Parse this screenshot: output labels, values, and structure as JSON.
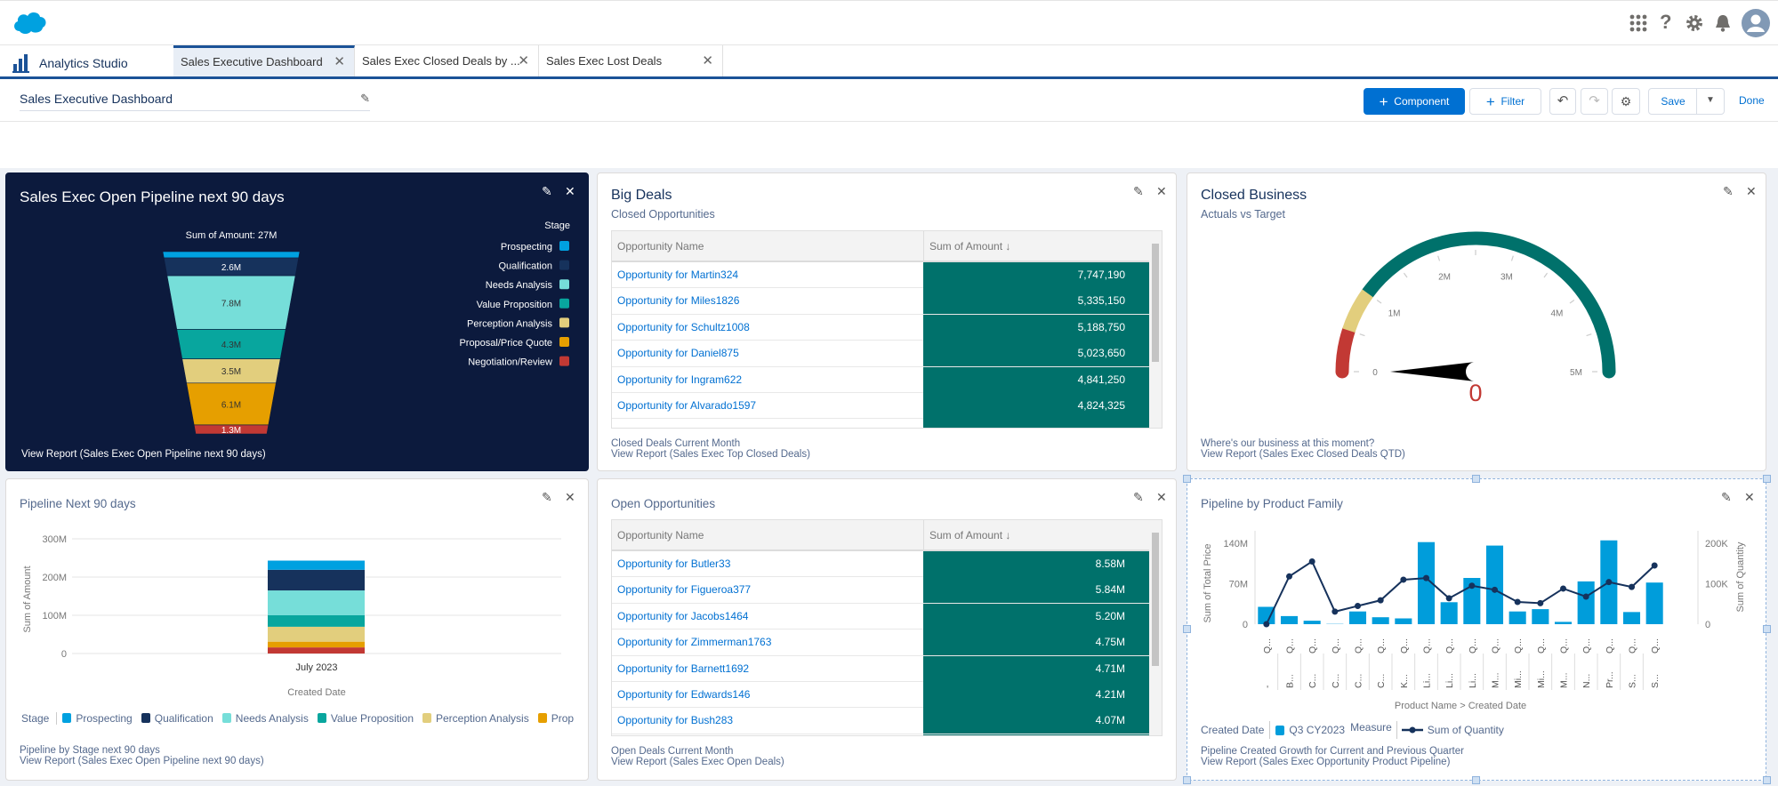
{
  "header": {
    "logo": "salesforce-cloud-logo",
    "icons": [
      "app-launcher-icon",
      "help-icon",
      "setup-gear-icon",
      "notification-bell-icon",
      "user-avatar"
    ]
  },
  "tabs": {
    "app_name": "Analytics Studio",
    "items": [
      {
        "label": "Sales Executive Dashboard",
        "active": true
      },
      {
        "label": "Sales Exec Closed Deals by ...",
        "active": false
      },
      {
        "label": "Sales Exec Lost Deals",
        "active": false
      }
    ]
  },
  "toolbar": {
    "dashboard_title": "Sales Executive Dashboard",
    "component_label": "Component",
    "filter_label": "Filter",
    "save_label": "Save",
    "done_label": "Done"
  },
  "widgets": {
    "funnel": {
      "title": "Sales Exec Open Pipeline next 90 days",
      "total_label": "Sum of Amount: 27M",
      "legend_title": "Stage",
      "footer_link": "View Report (Sales Exec Open Pipeline next 90 days)"
    },
    "big_deals": {
      "title": "Big Deals",
      "subtitle": "Closed Opportunities",
      "columns": [
        "Opportunity Name",
        "Sum of Amount ↓"
      ],
      "rows": [
        [
          "Opportunity for Martin324",
          "7,747,190"
        ],
        [
          "Opportunity for Miles1826",
          "5,335,150"
        ],
        [
          "Opportunity for Schultz1008",
          "5,188,750"
        ],
        [
          "Opportunity for Daniel875",
          "5,023,650"
        ],
        [
          "Opportunity for Ingram622",
          "4,841,250"
        ],
        [
          "Opportunity for Alvarado1597",
          "4,824,325"
        ]
      ],
      "footer_text": "Closed Deals Current Month",
      "footer_link": "View Report (Sales Exec Top Closed Deals)"
    },
    "closed_business": {
      "title": "Closed Business",
      "subtitle": "Actuals vs Target",
      "value_label": "0",
      "footer_text": "Where's our business at this moment?",
      "footer_link": "View Report (Sales Exec Closed Deals QTD)"
    },
    "pipeline_next": {
      "title": "Pipeline Next 90 days",
      "legend_title": "Stage",
      "footer_text": "Pipeline by Stage next 90 days",
      "footer_link": "View Report (Sales Exec Open Pipeline next 90 days)"
    },
    "open_opps": {
      "title": "Open Opportunities",
      "columns": [
        "Opportunity Name",
        "Sum of Amount ↓"
      ],
      "rows": [
        [
          "Opportunity for Butler33",
          "8.58M"
        ],
        [
          "Opportunity for Figueroa377",
          "5.84M"
        ],
        [
          "Opportunity for Jacobs1464",
          "5.20M"
        ],
        [
          "Opportunity for Zimmerman1763",
          "4.75M"
        ],
        [
          "Opportunity for Barnett1692",
          "4.71M"
        ],
        [
          "Opportunity for Edwards146",
          "4.21M"
        ],
        [
          "Opportunity for Bush283",
          "4.07M"
        ]
      ],
      "footer_text": "Open Deals Current Month",
      "footer_link": "View Report (Sales Exec Open Deals)"
    },
    "product_family": {
      "title": "Pipeline by Product Family",
      "legend": {
        "dim_title": "Created Date",
        "dim_item": "Q3 CY2023",
        "measure_title": "Measure",
        "measure_item": "Sum of Quantity"
      },
      "footer_text": "Pipeline Created Growth for Current and Previous Quarter",
      "footer_link": "View Report (Sales Exec Opportunity Product Pipeline)"
    }
  },
  "colors": {
    "prospecting": "#00a1e0",
    "qualification": "#16325c",
    "needs_analysis": "#76ded9",
    "value_proposition": "#08a69e",
    "perception_analysis": "#e2ce7d",
    "proposal": "#e69f00",
    "negotiation": "#c23934",
    "table_bar": "#00716b",
    "brand": "#0070d2",
    "bar_blue": "#009ddb",
    "line_navy": "#16325c"
  },
  "chart_data": [
    {
      "type": "funnel",
      "title": "Sales Exec Open Pipeline next 90 days",
      "total": "Sum of Amount: 27M",
      "legend_position": "right",
      "stages": [
        {
          "name": "Prospecting",
          "color": "#00a1e0",
          "label": ""
        },
        {
          "name": "Qualification",
          "color": "#16325c",
          "value": 2.6,
          "label": "2.6M"
        },
        {
          "name": "Needs Analysis",
          "color": "#76ded9",
          "value": 7.8,
          "label": "7.8M"
        },
        {
          "name": "Value Proposition",
          "color": "#08a69e",
          "value": 4.3,
          "label": "4.3M"
        },
        {
          "name": "Perception Analysis",
          "color": "#e2ce7d",
          "value": 3.5,
          "label": "3.5M"
        },
        {
          "name": "Proposal/Price Quote",
          "color": "#e69f00",
          "value": 6.1,
          "label": "6.1M"
        },
        {
          "name": "Negotiation/Review",
          "color": "#c23934",
          "value": 1.3,
          "label": "1.3M"
        }
      ]
    },
    {
      "type": "gauge",
      "min": 0,
      "max": 5,
      "unit": "M",
      "value": 0,
      "tick_labels": [
        "0",
        "1M",
        "2M",
        "3M",
        "4M",
        "5M"
      ],
      "bands": [
        {
          "from": 0,
          "to": 0.5,
          "color": "#c23934"
        },
        {
          "from": 0.5,
          "to": 1,
          "color": "#e2ce7d"
        },
        {
          "from": 1,
          "to": 5,
          "color": "#00716b"
        }
      ]
    },
    {
      "type": "bar",
      "stacked": true,
      "categories": [
        "July 2023"
      ],
      "xlabel": "Created Date",
      "ylabel": "Sum of Amount",
      "ylim": [
        0,
        300
      ],
      "yticks": [
        "0",
        "100M",
        "200M",
        "300M"
      ],
      "grid": true,
      "legend_position": "bottom",
      "series": [
        {
          "name": "Negotiation/Review",
          "color": "#c23934",
          "values": [
            16
          ]
        },
        {
          "name": "Proposal/Price Quote",
          "color": "#e69f00",
          "values": [
            15
          ]
        },
        {
          "name": "Perception Analysis",
          "color": "#e2ce7d",
          "values": [
            39
          ]
        },
        {
          "name": "Value Proposition",
          "color": "#08a69e",
          "values": [
            30
          ]
        },
        {
          "name": "Needs Analysis",
          "color": "#76ded9",
          "values": [
            65
          ]
        },
        {
          "name": "Qualification",
          "color": "#16325c",
          "values": [
            54
          ]
        },
        {
          "name": "Prospecting",
          "color": "#00a1e0",
          "values": [
            24
          ]
        }
      ],
      "legend": [
        "Prospecting",
        "Qualification",
        "Needs Analysis",
        "Value Proposition",
        "Perception Analysis",
        "Prop"
      ]
    },
    {
      "type": "bar+line",
      "xlabel": "Product Name > Created Date",
      "ylabel": "Sum of Total Price",
      "y2label": "Sum of Quantity",
      "yticks": [
        "0",
        "70M",
        "140M"
      ],
      "y2ticks": [
        "0",
        "100K",
        "200K"
      ],
      "ylim": [
        0,
        140
      ],
      "y2lim": [
        0,
        200
      ],
      "categories": [
        [
          "-",
          "Q..."
        ],
        [
          "B...",
          "Q..."
        ],
        [
          "C...",
          "Q..."
        ],
        [
          "C...",
          "Q..."
        ],
        [
          "C...",
          "Q..."
        ],
        [
          "C...",
          "Q..."
        ],
        [
          "K...",
          "Q..."
        ],
        [
          "Li...",
          "Q..."
        ],
        [
          "Li...",
          "Q..."
        ],
        [
          "Li...",
          "Q..."
        ],
        [
          "M...",
          "Q..."
        ],
        [
          "Mi...",
          "Q..."
        ],
        [
          "Mi...",
          "Q..."
        ],
        [
          "M...",
          "Q..."
        ],
        [
          "N...",
          "Q..."
        ],
        [
          "Pr...",
          "Q..."
        ],
        [
          "S...",
          "Q..."
        ],
        [
          "S...",
          "Q..."
        ]
      ],
      "series": [
        {
          "name": "Q3 CY2023",
          "kind": "bar",
          "axis": "left",
          "unit": "M",
          "color": "#009ddb",
          "values": [
            30,
            14,
            6,
            1,
            22,
            12,
            10,
            142,
            38,
            80,
            136,
            22,
            26,
            4,
            74,
            145,
            21,
            72
          ]
        },
        {
          "name": "Sum of Quantity",
          "kind": "line",
          "axis": "right",
          "unit": "K",
          "color": "#16325c",
          "values": [
            0,
            118,
            155,
            31,
            45,
            59,
            110,
            114,
            64,
            95,
            85,
            55,
            52,
            88,
            68,
            104,
            92,
            145
          ]
        }
      ]
    }
  ]
}
